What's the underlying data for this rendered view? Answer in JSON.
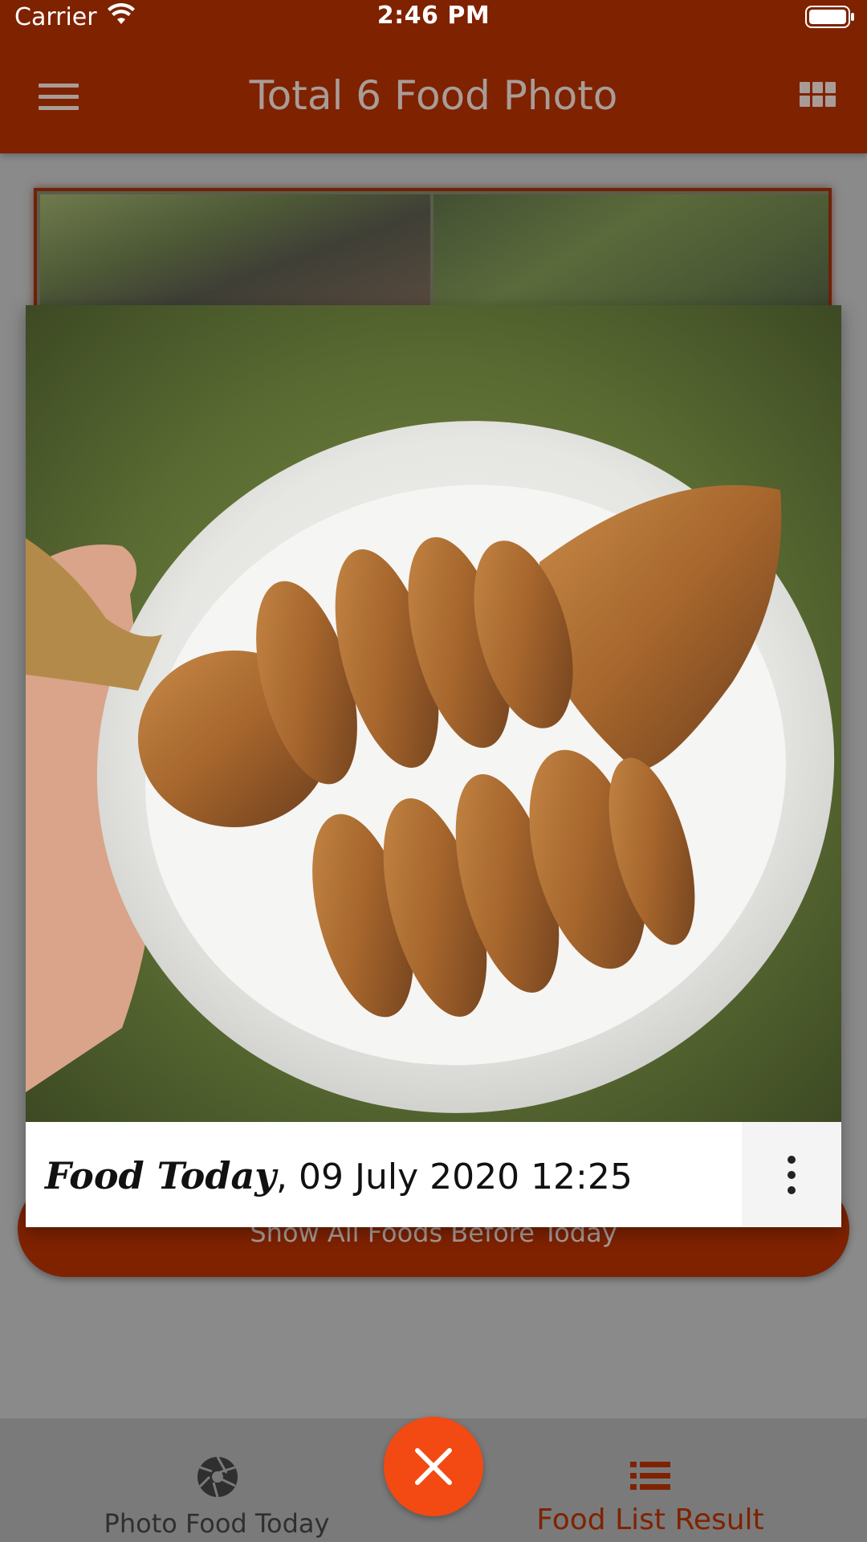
{
  "status_bar": {
    "carrier": "Carrier",
    "time": "2:46 PM"
  },
  "nav_bar": {
    "title": "Total 6 Food Photo",
    "left_icon": "menu-icon",
    "right_icon": "grid-icon"
  },
  "background": {
    "show_all_button": "Show All Foods Before Today"
  },
  "photo_popup": {
    "caption_title": "Food Today",
    "caption_date": "09 July 2020 12:25",
    "more_icon": "more-vertical-icon"
  },
  "tab_bar": {
    "photo_tab_label": "Photo Food Today",
    "photo_tab_icon": "camera-shutter-icon",
    "list_tab_label": "Food List Result",
    "list_tab_icon": "list-icon",
    "close_icon": "close-icon"
  },
  "colors": {
    "brand": "#7f2200",
    "close_button": "#f24a12",
    "overlay": "#8a8a8a"
  }
}
